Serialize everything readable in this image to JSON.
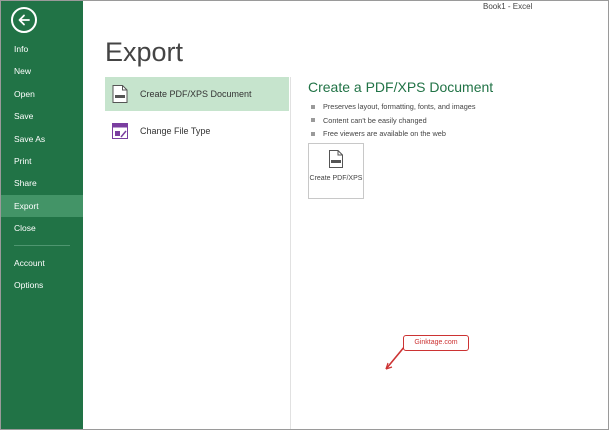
{
  "window": {
    "title": "Book1 - Excel"
  },
  "sidebar": {
    "items": [
      {
        "label": "Info",
        "active": false
      },
      {
        "label": "New",
        "active": false
      },
      {
        "label": "Open",
        "active": false
      },
      {
        "label": "Save",
        "active": false
      },
      {
        "label": "Save As",
        "active": false
      },
      {
        "label": "Print",
        "active": false
      },
      {
        "label": "Share",
        "active": false
      },
      {
        "label": "Export",
        "active": true
      },
      {
        "label": "Close",
        "active": false
      }
    ],
    "bottom_items": [
      {
        "label": "Account"
      },
      {
        "label": "Options"
      }
    ]
  },
  "page": {
    "heading": "Export"
  },
  "options": [
    {
      "label": "Create PDF/XPS Document",
      "selected": true,
      "icon": "pdf-document-icon"
    },
    {
      "label": "Change File Type",
      "selected": false,
      "icon": "change-file-type-icon"
    }
  ],
  "detail": {
    "heading": "Create a PDF/XPS Document",
    "bullets": [
      "Preserves layout, formatting, fonts, and images",
      "Content can't be easily changed",
      "Free viewers are available on the web"
    ],
    "button_label": "Create PDF/XPS"
  },
  "watermark": {
    "text": "Ginktage.com"
  },
  "colors": {
    "sidebar_bg": "#217346",
    "sidebar_active": "#439467",
    "selected_option": "#c6e4cd",
    "accent": "#217346",
    "watermark": "#cc3333"
  }
}
